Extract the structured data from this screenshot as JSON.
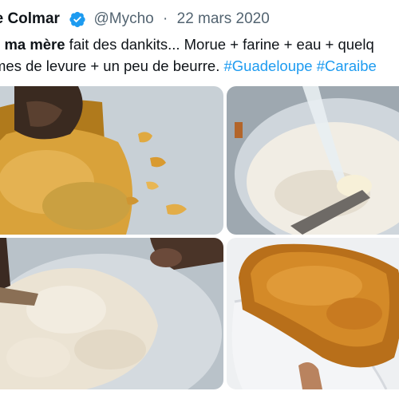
{
  "tweet": {
    "author_name": "ne Colmar",
    "handle": "@Mycho",
    "separator": "·",
    "date": "22 mars 2020",
    "text": {
      "line1_prefix": "d ",
      "line1_bold": "ma mère",
      "line1_rest": " fait des dankits... Morue + farine + eau + quelq",
      "line2_text": "mes de levure + un peu de beurre. ",
      "hashtags": [
        "#Guadeloupe",
        "#Caraibe"
      ]
    }
  },
  "media": {
    "photos": [
      {
        "subject": "shredded-cod"
      },
      {
        "subject": "flour-water-bowl"
      },
      {
        "subject": "dough-bowl"
      },
      {
        "subject": "fried-dankit"
      }
    ]
  },
  "colors": {
    "text": "#0f1419",
    "muted": "#536471",
    "link": "#1d9bf0",
    "verified": "#1d9bf0"
  }
}
